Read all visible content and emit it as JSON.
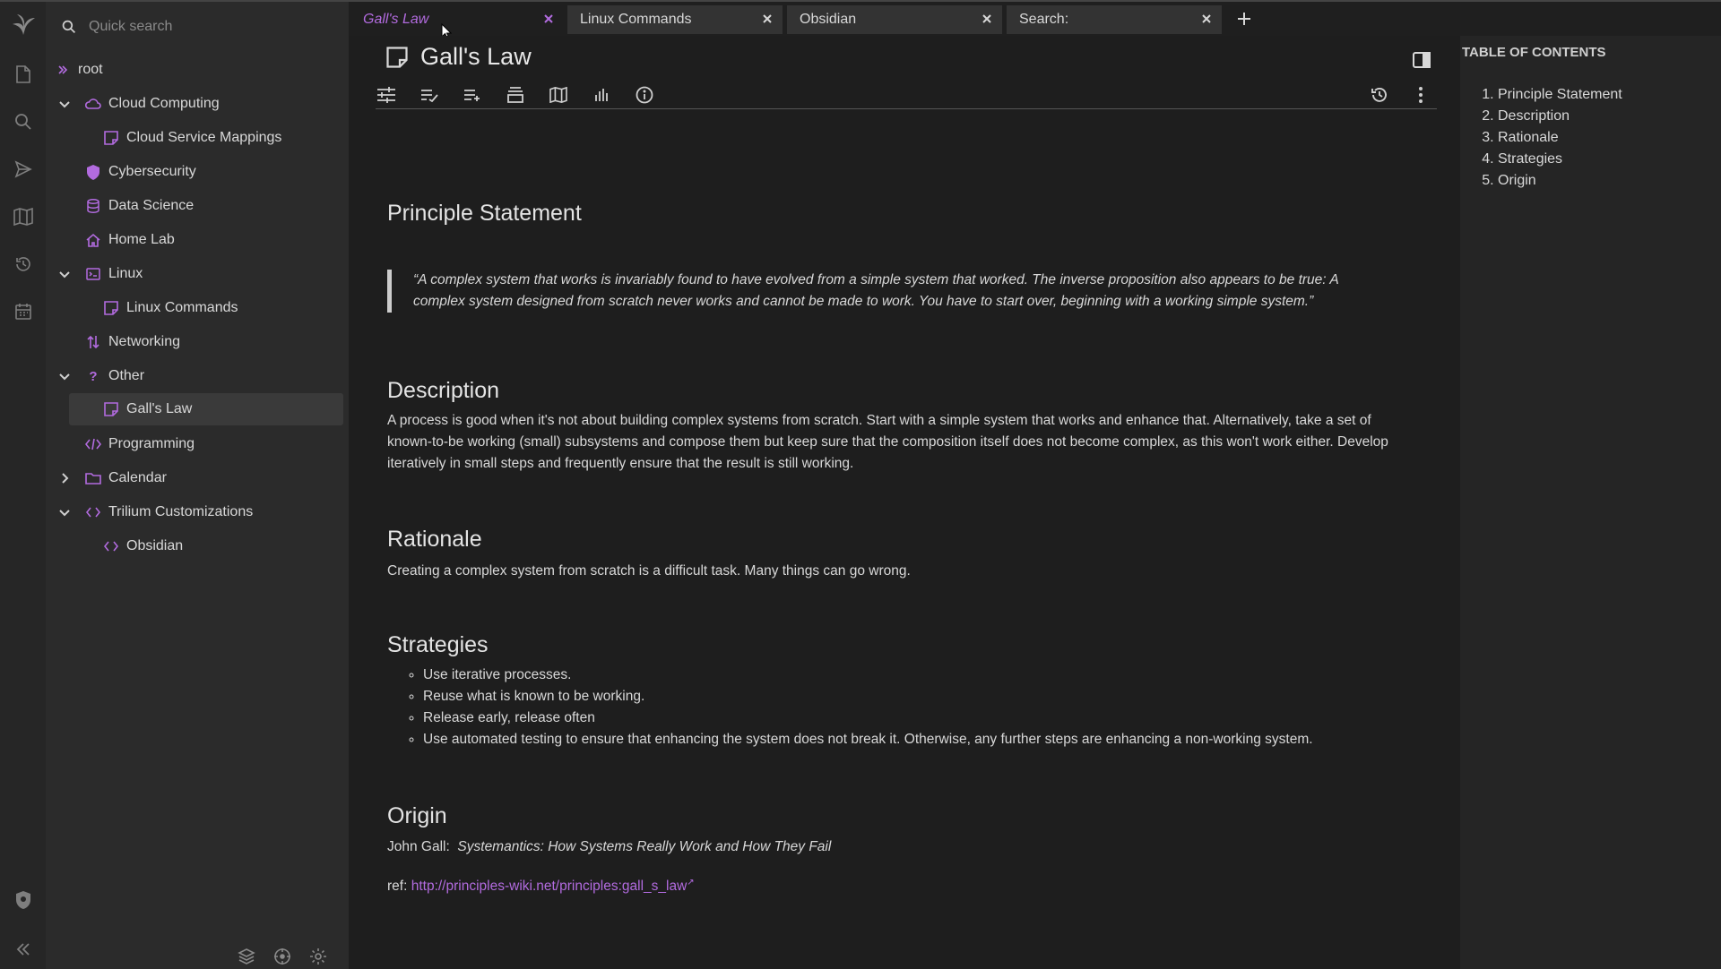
{
  "colors": {
    "accent": "#b26bdf",
    "background": "#1e1e1e",
    "sidebar": "#2b2b2b",
    "launcher": "#262626"
  },
  "quick_search": {
    "placeholder": "Quick search"
  },
  "tree": {
    "root": "root",
    "items": [
      {
        "label": "Cloud Computing",
        "icon": "cloud-icon",
        "expanded": true
      },
      {
        "label": "Cloud Service Mappings",
        "icon": "note-icon"
      },
      {
        "label": "Cybersecurity",
        "icon": "shield-icon"
      },
      {
        "label": "Data Science",
        "icon": "database-icon"
      },
      {
        "label": "Home Lab",
        "icon": "home-icon"
      },
      {
        "label": "Linux",
        "icon": "terminal-icon",
        "expanded": true
      },
      {
        "label": "Linux Commands",
        "icon": "note-icon"
      },
      {
        "label": "Networking",
        "icon": "sort-arrows-icon"
      },
      {
        "label": "Other",
        "icon": "question-icon",
        "expanded": true
      },
      {
        "label": "Gall's Law",
        "icon": "note-icon",
        "active": true
      },
      {
        "label": "Programming",
        "icon": "code-icon"
      },
      {
        "label": "Calendar",
        "icon": "folder-icon",
        "expanded": false
      },
      {
        "label": "Trilium Customizations",
        "icon": "code-icon",
        "expanded": true
      },
      {
        "label": "Obsidian",
        "icon": "code-icon"
      }
    ]
  },
  "tabs": [
    {
      "label": "Gall's Law",
      "active": true
    },
    {
      "label": "Linux Commands"
    },
    {
      "label": "Obsidian"
    },
    {
      "label": "Search:"
    }
  ],
  "note": {
    "title": "Gall's Law",
    "sections": {
      "principle": {
        "heading": "Principle Statement",
        "quote_line1": "“A complex system that works is invariably found to have evolved from a simple system that worked. The inverse proposition also appears to be true: A",
        "quote_line2": "complex system designed from scratch never works and cannot be made to work. You have to start over, beginning with a working simple system.”"
      },
      "description": {
        "heading": "Description",
        "line1": "A process is good when it's not about building complex systems from scratch. Start with a simple system that works and enhance that. Alternatively, take a set of",
        "line2": "known-to-be working (small) subsystems and compose them but keep sure that the composition itself does not become complex, as this won't work either. Develop",
        "line3": "iteratively in small steps and frequently ensure that the result is still working."
      },
      "rationale": {
        "heading": "Rationale",
        "text": "Creating a complex system from scratch is a difficult task. Many things can go wrong."
      },
      "strategies": {
        "heading": "Strategies",
        "items": [
          "Use iterative processes.",
          "Reuse what is known to be working.",
          "Release early, release often",
          "Use automated testing to ensure that enhancing the system does not break it. Otherwise, any further steps are enhancing a non-working system."
        ]
      },
      "origin": {
        "heading": "Origin",
        "author": "John Gall:",
        "book": "Systemantics: How Systems Really Work and How They Fail",
        "ref_label": "ref:",
        "ref_link": "http://principles-wiki.net/principles:gall_s_law",
        "ref_suffix": "↗"
      }
    }
  },
  "toc": {
    "title": "TABLE OF CONTENTS",
    "items": [
      "Principle Statement",
      "Description",
      "Rationale",
      "Strategies",
      "Origin"
    ]
  }
}
